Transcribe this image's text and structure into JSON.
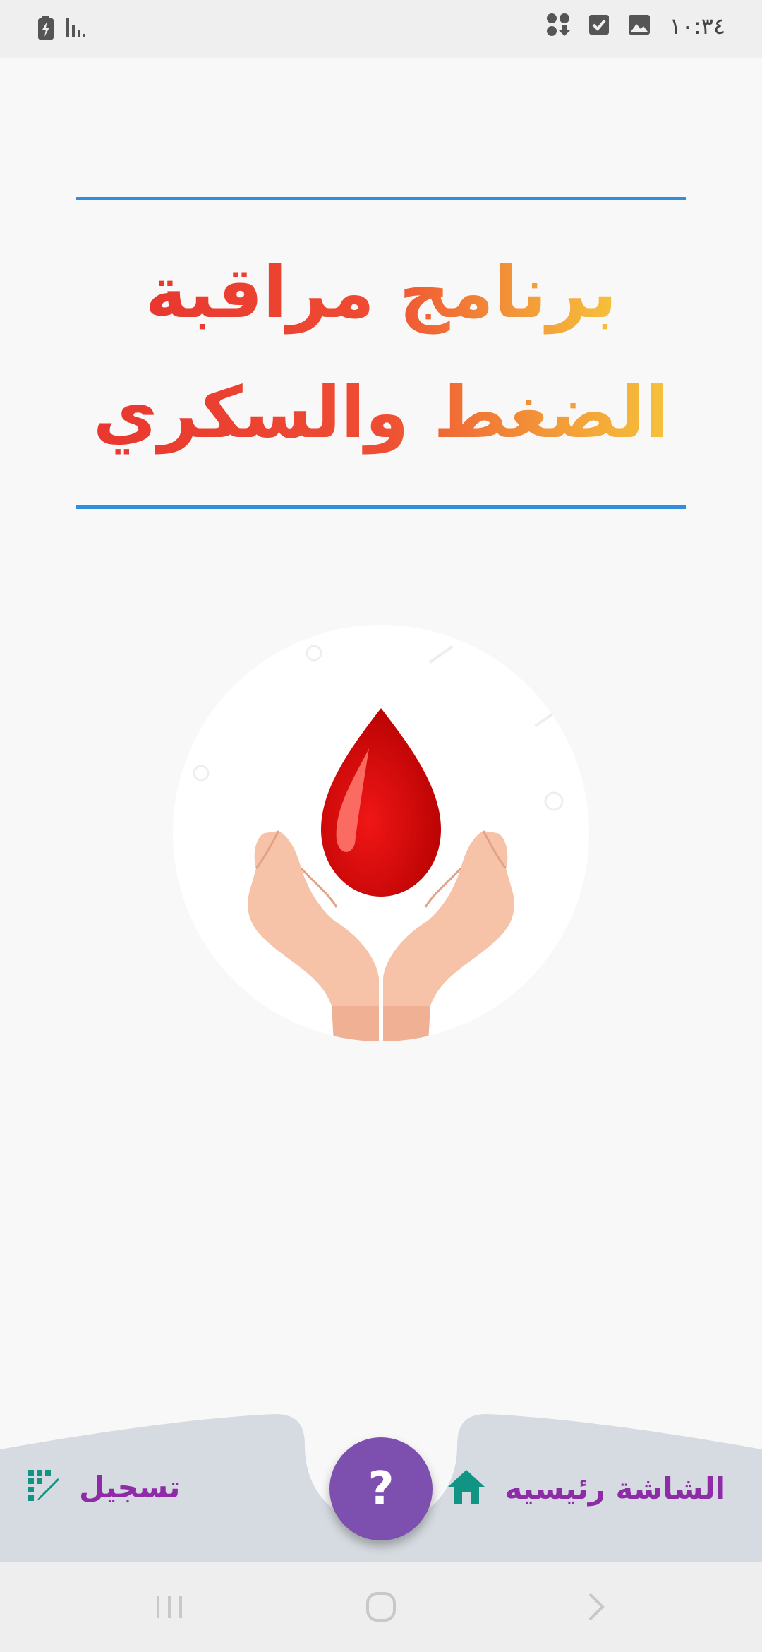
{
  "status_bar": {
    "time": "١٠:٣٤",
    "icons": [
      "battery-charging-icon",
      "signal-icon",
      "download-app-icon",
      "checkbox-icon",
      "image-icon"
    ]
  },
  "header": {
    "title_line_1": "برنامج مراقبة",
    "title_line_2": "الضغط والسكري"
  },
  "illustration": {
    "icon": "blood-drop-hands-icon"
  },
  "bottom_nav": {
    "home_label": "الشاشة رئيسيه",
    "home_icon": "home-icon",
    "record_label": "تسجيل",
    "record_icon": "grid-edit-icon",
    "help_label": "?"
  },
  "system_nav": {
    "icons": [
      "recents-icon",
      "home-circle-icon",
      "back-icon"
    ]
  },
  "colors": {
    "title_gradient_start": "#e8372f",
    "title_gradient_end": "#f5c23b",
    "rule": "#2f8fde",
    "nav_label": "#8e2ca8",
    "nav_icon": "#129485",
    "fab": "#7d4fae",
    "nav_background": "#d5dbe0"
  }
}
